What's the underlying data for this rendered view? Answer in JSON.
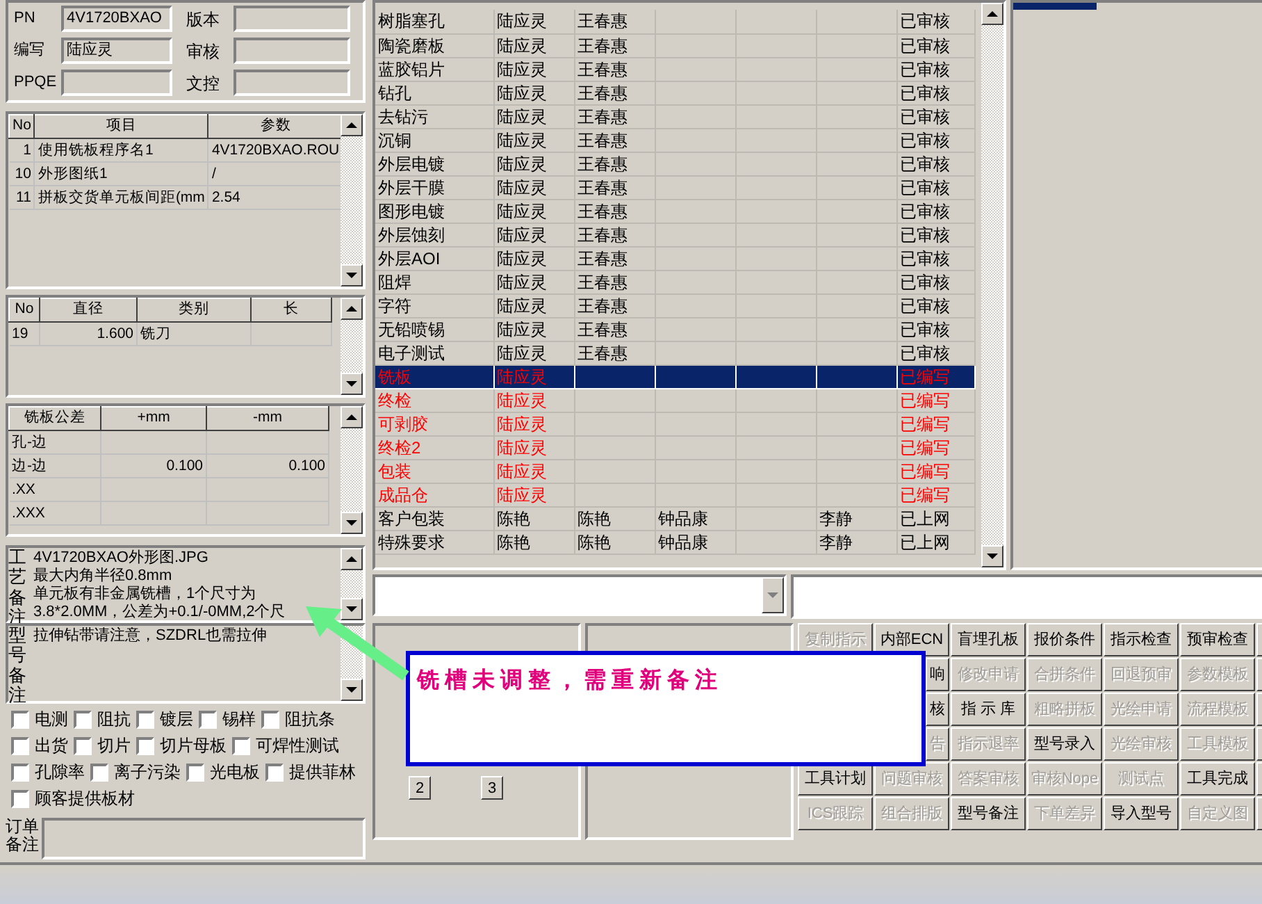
{
  "form": {
    "fields": [
      {
        "label": "PN",
        "value": "4V1720BXAO"
      },
      {
        "label": "版本"
      },
      {
        "label": "编写",
        "value": "陆应灵"
      },
      {
        "label": "审核"
      },
      {
        "label": "PPQE"
      },
      {
        "label": "文控"
      }
    ]
  },
  "params_table": {
    "columns": [
      "No",
      "项目",
      "参数"
    ],
    "rows": [
      [
        "1",
        "使用铣板程序名1",
        "4V1720BXAO.ROU"
      ],
      [
        "10",
        "外形图纸1",
        "/"
      ],
      [
        "11",
        "拼板交货单元板间距(mm",
        "2.54"
      ]
    ]
  },
  "tools_table": {
    "columns": [
      "No",
      "直径",
      "类别",
      "长"
    ],
    "rows": [
      [
        "19",
        "1.600",
        "铣刀",
        null
      ]
    ]
  },
  "tolerance_table": {
    "columns": [
      "铣板公差",
      "+mm",
      "-mm"
    ],
    "rows": [
      [
        "孔-边",
        null,
        null
      ],
      [
        "边-边",
        "0.100",
        "0.100"
      ],
      [
        ".XX",
        null,
        null
      ],
      [
        ".XXX",
        null,
        null
      ]
    ]
  },
  "process_note": {
    "label": "工艺备注",
    "lines": [
      "4V1720BXAO外形图.JPG",
      "最大内角半径0.8mm",
      "单元板有非金属铣槽，1个尺寸为",
      "3.8*2.0MM，公差为+0.1/-0MM,2个尺"
    ]
  },
  "model_note": {
    "label": "型号备注",
    "text": "拉伸钻带请注意，SZDRL也需拉伸"
  },
  "options": [
    {
      "label": "电测",
      "checked": false
    },
    {
      "label": "阻抗",
      "checked": false
    },
    {
      "label": "镀层",
      "checked": false
    },
    {
      "label": "锡样",
      "checked": false
    },
    {
      "label": "阻抗条",
      "checked": false
    },
    {
      "label": "出货",
      "checked": false
    },
    {
      "label": "切片",
      "checked": false
    },
    {
      "label": "切片母板",
      "checked": false
    },
    {
      "label": "可焊性测试",
      "checked": false
    },
    {
      "label": "孔隙率",
      "checked": false
    },
    {
      "label": "离子污染",
      "checked": false
    },
    {
      "label": "光电板",
      "checked": false
    },
    {
      "label": "提供菲林",
      "checked": false
    },
    {
      "label": "顾客提供板材",
      "checked": false
    }
  ],
  "order_note": {
    "label": "订单备注"
  },
  "process_table": {
    "rows": [
      {
        "cells": [
          "树脂塞孔",
          "陆应灵",
          "王春惠",
          null,
          null,
          null,
          "已审核"
        ],
        "color": "#000000",
        "selected": false
      },
      {
        "cells": [
          "陶瓷磨板",
          "陆应灵",
          "王春惠",
          null,
          null,
          null,
          "已审核"
        ],
        "color": "#000000",
        "selected": false
      },
      {
        "cells": [
          "蓝胶铝片",
          "陆应灵",
          "王春惠",
          null,
          null,
          null,
          "已审核"
        ],
        "color": "#000000",
        "selected": false
      },
      {
        "cells": [
          "钻孔",
          "陆应灵",
          "王春惠",
          null,
          null,
          null,
          "已审核"
        ],
        "color": "#000000",
        "selected": false
      },
      {
        "cells": [
          "去钻污",
          "陆应灵",
          "王春惠",
          null,
          null,
          null,
          "已审核"
        ],
        "color": "#000000",
        "selected": false
      },
      {
        "cells": [
          "沉铜",
          "陆应灵",
          "王春惠",
          null,
          null,
          null,
          "已审核"
        ],
        "color": "#000000",
        "selected": false
      },
      {
        "cells": [
          "外层电镀",
          "陆应灵",
          "王春惠",
          null,
          null,
          null,
          "已审核"
        ],
        "color": "#000000",
        "selected": false
      },
      {
        "cells": [
          "外层干膜",
          "陆应灵",
          "王春惠",
          null,
          null,
          null,
          "已审核"
        ],
        "color": "#000000",
        "selected": false
      },
      {
        "cells": [
          "图形电镀",
          "陆应灵",
          "王春惠",
          null,
          null,
          null,
          "已审核"
        ],
        "color": "#000000",
        "selected": false
      },
      {
        "cells": [
          "外层蚀刻",
          "陆应灵",
          "王春惠",
          null,
          null,
          null,
          "已审核"
        ],
        "color": "#000000",
        "selected": false
      },
      {
        "cells": [
          "外层AOI",
          "陆应灵",
          "王春惠",
          null,
          null,
          null,
          "已审核"
        ],
        "color": "#000000",
        "selected": false
      },
      {
        "cells": [
          "阻焊",
          "陆应灵",
          "王春惠",
          null,
          null,
          null,
          "已审核"
        ],
        "color": "#000000",
        "selected": false
      },
      {
        "cells": [
          "字符",
          "陆应灵",
          "王春惠",
          null,
          null,
          null,
          "已审核"
        ],
        "color": "#000000",
        "selected": false
      },
      {
        "cells": [
          "无铅喷锡",
          "陆应灵",
          "王春惠",
          null,
          null,
          null,
          "已审核"
        ],
        "color": "#000000",
        "selected": false
      },
      {
        "cells": [
          "电子测试",
          "陆应灵",
          "王春惠",
          null,
          null,
          null,
          "已审核"
        ],
        "color": "#000000",
        "selected": false
      },
      {
        "cells": [
          "铣板",
          "陆应灵",
          null,
          null,
          null,
          null,
          "已编写"
        ],
        "color": "#ff0000",
        "selected": true
      },
      {
        "cells": [
          "终检",
          "陆应灵",
          null,
          null,
          null,
          null,
          "已编写"
        ],
        "color": "#ff0000",
        "selected": false
      },
      {
        "cells": [
          "可剥胶",
          "陆应灵",
          null,
          null,
          null,
          null,
          "已编写"
        ],
        "color": "#ff0000",
        "selected": false
      },
      {
        "cells": [
          "终检2",
          "陆应灵",
          null,
          null,
          null,
          null,
          "已编写"
        ],
        "color": "#ff0000",
        "selected": false
      },
      {
        "cells": [
          "包装",
          "陆应灵",
          null,
          null,
          null,
          null,
          "已编写"
        ],
        "color": "#ff0000",
        "selected": false
      },
      {
        "cells": [
          "成品仓",
          "陆应灵",
          null,
          null,
          null,
          null,
          "已编写"
        ],
        "color": "#ff0000",
        "selected": false
      },
      {
        "cells": [
          "客户包装",
          "陈艳",
          "陈艳",
          "钟品康",
          null,
          "李静",
          "已上网"
        ],
        "color": "#000000",
        "selected": false
      },
      {
        "cells": [
          "特殊要求",
          "陈艳",
          "陈艳",
          "钟品康",
          null,
          "李静",
          "已上网"
        ],
        "color": "#000000",
        "selected": false
      }
    ]
  },
  "page_buttons": [
    "2",
    "3"
  ],
  "actions": [
    [
      {
        "label": "复制指示",
        "disabled": true,
        "kind": "full"
      },
      {
        "label": "内部ECN",
        "disabled": false,
        "kind": "full"
      },
      {
        "label": "盲埋孔板",
        "disabled": false,
        "kind": "full"
      },
      {
        "label": "报价条件",
        "disabled": false,
        "kind": "full"
      },
      {
        "label": "指示检查",
        "disabled": false,
        "kind": "full"
      },
      {
        "label": "预审检查",
        "disabled": false,
        "kind": "full"
      }
    ],
    [
      {
        "label": "响",
        "disabled": false,
        "kind": "covered"
      },
      {
        "label": "修改申请",
        "disabled": true,
        "kind": "full"
      },
      {
        "label": "合拼条件",
        "disabled": true,
        "kind": "full"
      },
      {
        "label": "回退预审",
        "disabled": true,
        "kind": "full"
      },
      {
        "label": "参数模板",
        "disabled": true,
        "kind": "full"
      }
    ],
    [
      {
        "label": "核",
        "disabled": false,
        "kind": "covered"
      },
      {
        "label": "指 示 库",
        "disabled": false,
        "kind": "full"
      },
      {
        "label": "粗略拼板",
        "disabled": true,
        "kind": "full"
      },
      {
        "label": "光绘申请",
        "disabled": true,
        "kind": "full"
      },
      {
        "label": "流程模板",
        "disabled": true,
        "kind": "full"
      }
    ],
    [
      {
        "label": "告",
        "disabled": true,
        "kind": "covered"
      },
      {
        "label": "指示退率",
        "disabled": true,
        "kind": "full"
      },
      {
        "label": "型号录入",
        "disabled": false,
        "kind": "full"
      },
      {
        "label": "光绘审核",
        "disabled": true,
        "kind": "full"
      },
      {
        "label": "工具模板",
        "disabled": true,
        "kind": "full"
      }
    ],
    [
      {
        "label": "工具计划",
        "disabled": false,
        "kind": "full"
      },
      {
        "label": "问题审核",
        "disabled": true,
        "kind": "full"
      },
      {
        "label": "答案审核",
        "disabled": true,
        "kind": "full"
      },
      {
        "label": "审核Nope",
        "disabled": true,
        "kind": "full"
      },
      {
        "label": "测试点",
        "disabled": true,
        "kind": "full"
      },
      {
        "label": "工具完成",
        "disabled": false,
        "kind": "full"
      }
    ],
    [
      {
        "label": "ICS跟踪",
        "disabled": true,
        "kind": "full"
      },
      {
        "label": "组合排版",
        "disabled": true,
        "kind": "full"
      },
      {
        "label": "型号备注",
        "disabled": false,
        "kind": "full"
      },
      {
        "label": "下单差异",
        "disabled": true,
        "kind": "full"
      },
      {
        "label": "导入型号",
        "disabled": false,
        "kind": "full"
      },
      {
        "label": "自定义图",
        "disabled": true,
        "kind": "full"
      }
    ]
  ],
  "callout": {
    "text": "铣槽未调整，需重新备注"
  }
}
